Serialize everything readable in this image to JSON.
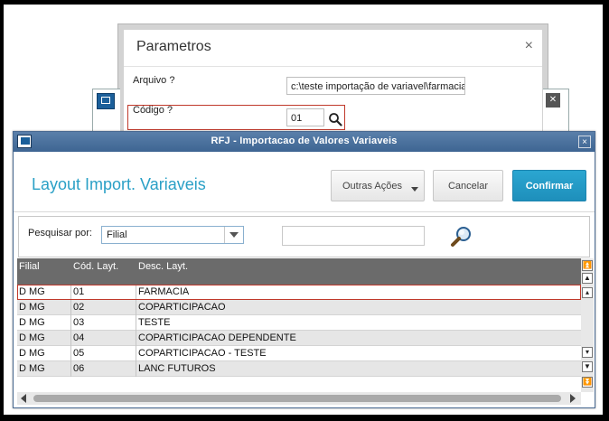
{
  "param_dialog": {
    "title": "Parametros",
    "close": "×",
    "arquivo_label": "Arquivo ?",
    "arquivo_value": "c:\\teste importação de variavel\\farmacia",
    "codigo_label": "Código ?",
    "codigo_value": "01"
  },
  "window": {
    "title": "RFJ - Importacao de Valores Variaveis",
    "close": "×"
  },
  "header": {
    "title": "Layout Import. Variaveis",
    "outras_acoes": "Outras Ações",
    "cancelar": "Cancelar",
    "confirmar": "Confirmar"
  },
  "search": {
    "label": "Pesquisar por:",
    "selected": "Filial",
    "value": ""
  },
  "grid": {
    "columns": [
      "Filial",
      "Cód. Layt.",
      "Desc. Layt."
    ],
    "rows": [
      [
        "D MG",
        "01",
        "FARMACIA"
      ],
      [
        "D MG",
        "02",
        "COPARTICIPACAO"
      ],
      [
        "D MG",
        "03",
        "TESTE"
      ],
      [
        "D MG",
        "04",
        "COPARTICIPACAO DEPENDENTE"
      ],
      [
        "D MG",
        "05",
        "COPARTICIPACAO - TESTE"
      ],
      [
        "D MG",
        "06",
        "LANC FUTUROS"
      ]
    ]
  },
  "colors": {
    "accent": "#2aa0c6",
    "confirm_button": "#1e8fbb",
    "titlebar": "#3e6592",
    "highlight_border": "#c0392b"
  },
  "icons": [
    "search-icon",
    "window-icon",
    "close-icon",
    "chevron-down-icon",
    "scroll-up-icon",
    "scroll-down-icon"
  ]
}
